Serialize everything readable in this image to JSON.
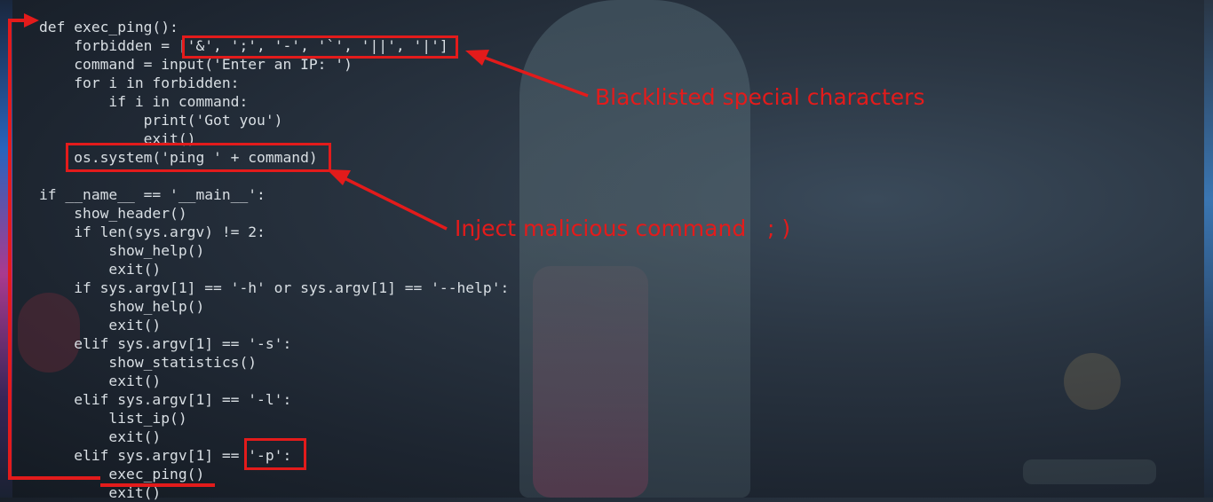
{
  "code_lines": [
    "def exec_ping():",
    "    forbidden = ['&', ';', '-', '`', '||', '|']",
    "    command = input('Enter an IP: ')",
    "    for i in forbidden:",
    "        if i in command:",
    "            print('Got you')",
    "            exit()",
    "    os.system('ping ' + command)",
    "",
    "if __name__ == '__main__':",
    "    show_header()",
    "    if len(sys.argv) != 2:",
    "        show_help()",
    "        exit()",
    "    if sys.argv[1] == '-h' or sys.argv[1] == '--help':",
    "        show_help()",
    "        exit()",
    "    elif sys.argv[1] == '-s':",
    "        show_statistics()",
    "        exit()",
    "    elif sys.argv[1] == '-l':",
    "        list_ip()",
    "        exit()",
    "    elif sys.argv[1] == '-p':",
    "        exec_ping()",
    "        exit()"
  ],
  "annotations": {
    "blacklist": "Blacklisted special characters",
    "inject": "Inject malicious command   ; )"
  },
  "colors": {
    "annotation": "#e31b1b",
    "code_text": "#d9dfe4"
  }
}
